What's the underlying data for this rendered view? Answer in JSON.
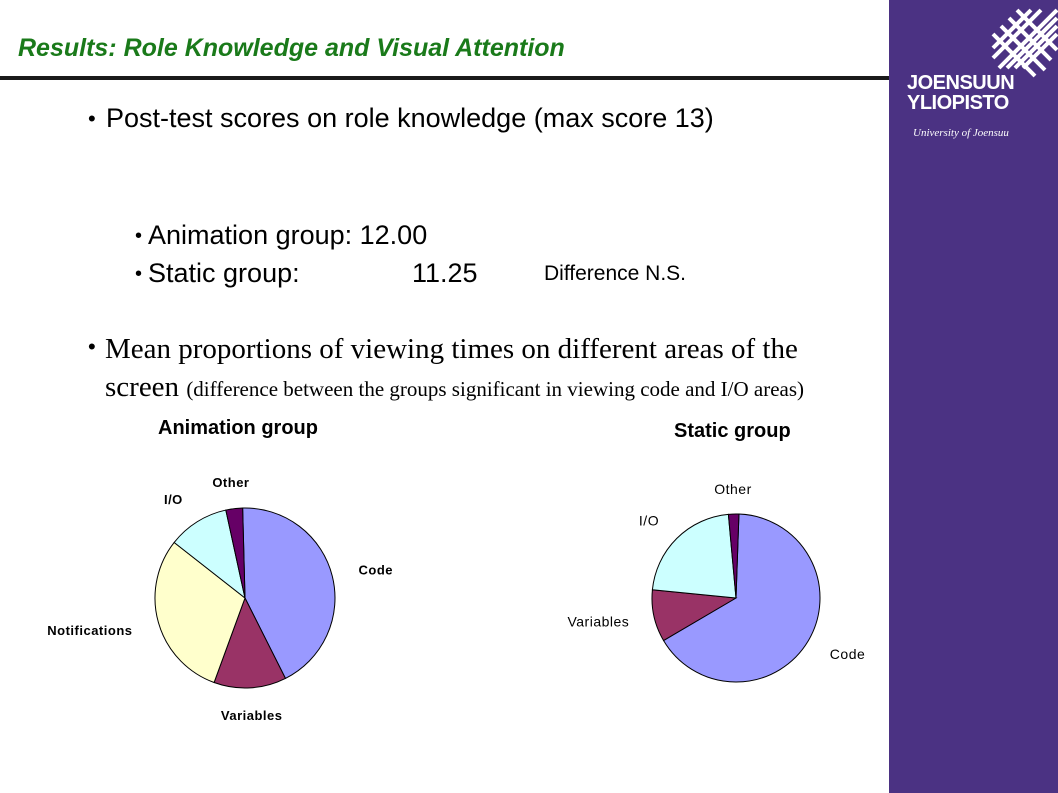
{
  "slide": {
    "title": "Results: Role Knowledge and Visual Attention",
    "bullet1": "Post-test scores on role knowledge (max score 13)",
    "animation_score_label": "Animation group: 12.00",
    "static_score_label": "Static group:",
    "static_score_value": "11.25",
    "difference_note": "Difference N.S.",
    "bullet2_main": "Mean proportions of viewing times on different areas of the screen",
    "bullet2_paren": "(difference between the groups significant in viewing code and I/O areas)"
  },
  "logo": {
    "line1": "JOENSUUN",
    "line2": "YLIOPISTO",
    "subtitle": "University of Joensuu"
  },
  "colors": {
    "sidebar": "#4b3283",
    "title": "#1a7a1a",
    "code": "#9999ff",
    "variables": "#993366",
    "notifications": "#ffffcc",
    "io": "#ccffff",
    "other": "#660066"
  },
  "chart_data": [
    {
      "type": "pie",
      "title": "Animation group",
      "categories": [
        "Code",
        "Variables",
        "Notifications",
        "I/O",
        "Other"
      ],
      "values": [
        43,
        13,
        30,
        11,
        3
      ]
    },
    {
      "type": "pie",
      "title": "Static group",
      "categories": [
        "Code",
        "Variables",
        "I/O",
        "Other"
      ],
      "values": [
        66,
        10,
        22,
        2
      ]
    }
  ]
}
